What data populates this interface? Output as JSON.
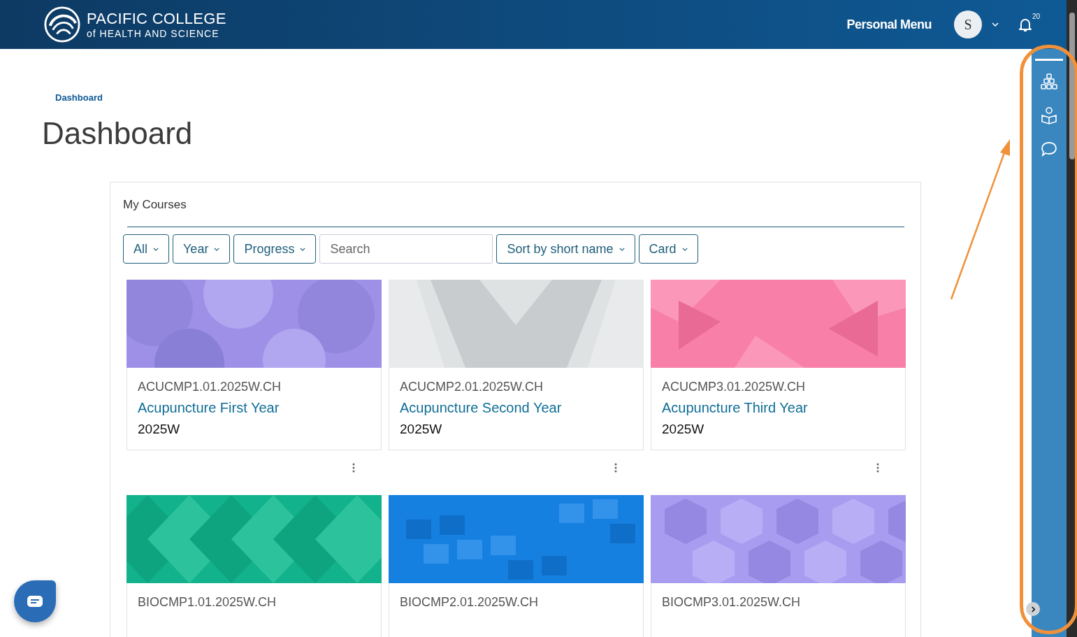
{
  "header": {
    "logo_line1": "PACIFIC COLLEGE",
    "logo_line2": "of HEALTH AND SCIENCE",
    "personal_menu": "Personal Menu",
    "avatar_initial": "S",
    "notifications_count": "20"
  },
  "breadcrumb": [
    "Dashboard"
  ],
  "page_title": "Dashboard",
  "my_courses": {
    "title": "My Courses",
    "filters": [
      {
        "kind": "dropdown",
        "label": "All"
      },
      {
        "kind": "dropdown",
        "label": "Year"
      },
      {
        "kind": "dropdown",
        "label": "Progress"
      },
      {
        "kind": "search",
        "placeholder": "Search"
      },
      {
        "kind": "dropdown",
        "label": "Sort by short name"
      },
      {
        "kind": "dropdown",
        "label": "Card"
      }
    ],
    "courses": [
      {
        "code": "ACUCMP1.01.2025W.CH",
        "name": "Acupuncture First Year",
        "term": "2025W"
      },
      {
        "code": "ACUCMP2.01.2025W.CH",
        "name": "Acupuncture Second Year",
        "term": "2025W"
      },
      {
        "code": "ACUCMP3.01.2025W.CH",
        "name": "Acupuncture Third Year",
        "term": "2025W"
      },
      {
        "code": "BIOCMP1.01.2025W.CH"
      },
      {
        "code": "BIOCMP2.01.2025W.CH"
      },
      {
        "code": "BIOCMP3.01.2025W.CH"
      }
    ]
  }
}
